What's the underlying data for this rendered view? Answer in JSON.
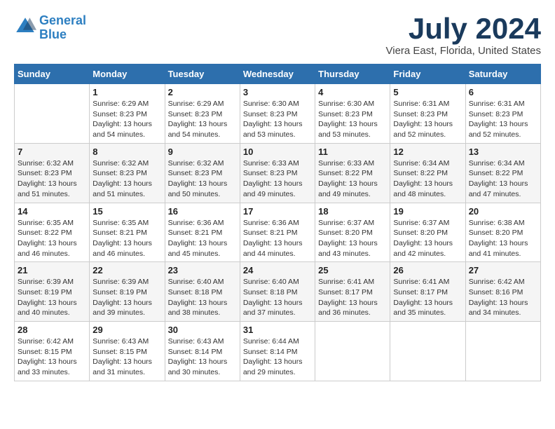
{
  "logo": {
    "line1": "General",
    "line2": "Blue"
  },
  "title": "July 2024",
  "location": "Viera East, Florida, United States",
  "days_header": [
    "Sunday",
    "Monday",
    "Tuesday",
    "Wednesday",
    "Thursday",
    "Friday",
    "Saturday"
  ],
  "weeks": [
    [
      {
        "day": "",
        "info": ""
      },
      {
        "day": "1",
        "info": "Sunrise: 6:29 AM\nSunset: 8:23 PM\nDaylight: 13 hours\nand 54 minutes."
      },
      {
        "day": "2",
        "info": "Sunrise: 6:29 AM\nSunset: 8:23 PM\nDaylight: 13 hours\nand 54 minutes."
      },
      {
        "day": "3",
        "info": "Sunrise: 6:30 AM\nSunset: 8:23 PM\nDaylight: 13 hours\nand 53 minutes."
      },
      {
        "day": "4",
        "info": "Sunrise: 6:30 AM\nSunset: 8:23 PM\nDaylight: 13 hours\nand 53 minutes."
      },
      {
        "day": "5",
        "info": "Sunrise: 6:31 AM\nSunset: 8:23 PM\nDaylight: 13 hours\nand 52 minutes."
      },
      {
        "day": "6",
        "info": "Sunrise: 6:31 AM\nSunset: 8:23 PM\nDaylight: 13 hours\nand 52 minutes."
      }
    ],
    [
      {
        "day": "7",
        "info": "Sunrise: 6:32 AM\nSunset: 8:23 PM\nDaylight: 13 hours\nand 51 minutes."
      },
      {
        "day": "8",
        "info": "Sunrise: 6:32 AM\nSunset: 8:23 PM\nDaylight: 13 hours\nand 51 minutes."
      },
      {
        "day": "9",
        "info": "Sunrise: 6:32 AM\nSunset: 8:23 PM\nDaylight: 13 hours\nand 50 minutes."
      },
      {
        "day": "10",
        "info": "Sunrise: 6:33 AM\nSunset: 8:23 PM\nDaylight: 13 hours\nand 49 minutes."
      },
      {
        "day": "11",
        "info": "Sunrise: 6:33 AM\nSunset: 8:22 PM\nDaylight: 13 hours\nand 49 minutes."
      },
      {
        "day": "12",
        "info": "Sunrise: 6:34 AM\nSunset: 8:22 PM\nDaylight: 13 hours\nand 48 minutes."
      },
      {
        "day": "13",
        "info": "Sunrise: 6:34 AM\nSunset: 8:22 PM\nDaylight: 13 hours\nand 47 minutes."
      }
    ],
    [
      {
        "day": "14",
        "info": "Sunrise: 6:35 AM\nSunset: 8:22 PM\nDaylight: 13 hours\nand 46 minutes."
      },
      {
        "day": "15",
        "info": "Sunrise: 6:35 AM\nSunset: 8:21 PM\nDaylight: 13 hours\nand 46 minutes."
      },
      {
        "day": "16",
        "info": "Sunrise: 6:36 AM\nSunset: 8:21 PM\nDaylight: 13 hours\nand 45 minutes."
      },
      {
        "day": "17",
        "info": "Sunrise: 6:36 AM\nSunset: 8:21 PM\nDaylight: 13 hours\nand 44 minutes."
      },
      {
        "day": "18",
        "info": "Sunrise: 6:37 AM\nSunset: 8:20 PM\nDaylight: 13 hours\nand 43 minutes."
      },
      {
        "day": "19",
        "info": "Sunrise: 6:37 AM\nSunset: 8:20 PM\nDaylight: 13 hours\nand 42 minutes."
      },
      {
        "day": "20",
        "info": "Sunrise: 6:38 AM\nSunset: 8:20 PM\nDaylight: 13 hours\nand 41 minutes."
      }
    ],
    [
      {
        "day": "21",
        "info": "Sunrise: 6:39 AM\nSunset: 8:19 PM\nDaylight: 13 hours\nand 40 minutes."
      },
      {
        "day": "22",
        "info": "Sunrise: 6:39 AM\nSunset: 8:19 PM\nDaylight: 13 hours\nand 39 minutes."
      },
      {
        "day": "23",
        "info": "Sunrise: 6:40 AM\nSunset: 8:18 PM\nDaylight: 13 hours\nand 38 minutes."
      },
      {
        "day": "24",
        "info": "Sunrise: 6:40 AM\nSunset: 8:18 PM\nDaylight: 13 hours\nand 37 minutes."
      },
      {
        "day": "25",
        "info": "Sunrise: 6:41 AM\nSunset: 8:17 PM\nDaylight: 13 hours\nand 36 minutes."
      },
      {
        "day": "26",
        "info": "Sunrise: 6:41 AM\nSunset: 8:17 PM\nDaylight: 13 hours\nand 35 minutes."
      },
      {
        "day": "27",
        "info": "Sunrise: 6:42 AM\nSunset: 8:16 PM\nDaylight: 13 hours\nand 34 minutes."
      }
    ],
    [
      {
        "day": "28",
        "info": "Sunrise: 6:42 AM\nSunset: 8:15 PM\nDaylight: 13 hours\nand 33 minutes."
      },
      {
        "day": "29",
        "info": "Sunrise: 6:43 AM\nSunset: 8:15 PM\nDaylight: 13 hours\nand 31 minutes."
      },
      {
        "day": "30",
        "info": "Sunrise: 6:43 AM\nSunset: 8:14 PM\nDaylight: 13 hours\nand 30 minutes."
      },
      {
        "day": "31",
        "info": "Sunrise: 6:44 AM\nSunset: 8:14 PM\nDaylight: 13 hours\nand 29 minutes."
      },
      {
        "day": "",
        "info": ""
      },
      {
        "day": "",
        "info": ""
      },
      {
        "day": "",
        "info": ""
      }
    ]
  ]
}
